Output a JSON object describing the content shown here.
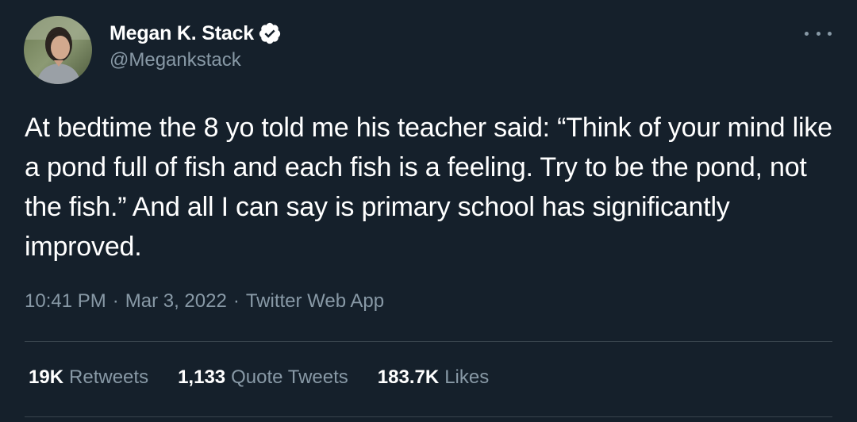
{
  "author": {
    "display_name": "Megan K. Stack",
    "handle": "@Megankstack",
    "verified": true
  },
  "tweet": {
    "text": "At bedtime the 8 yo told me his teacher said: “Think of your mind like a pond full of fish and each fish is a feeling. Try to be the pond, not the fish.” And all I can say is primary school has significantly improved.",
    "time": "10:41 PM",
    "date": "Mar 3, 2022",
    "source": "Twitter Web App",
    "separator": "·"
  },
  "stats": [
    {
      "value": "19K",
      "label": "Retweets"
    },
    {
      "value": "1,133",
      "label": "Quote Tweets"
    },
    {
      "value": "183.7K",
      "label": "Likes"
    }
  ],
  "colors": {
    "background": "#15202b",
    "primary_text": "#ffffff",
    "secondary_text": "#8899a6",
    "divider": "#38444d",
    "verified_badge": "#ffffff"
  },
  "icons": {
    "verified": "verified-badge-icon",
    "more": "more-options-icon"
  }
}
